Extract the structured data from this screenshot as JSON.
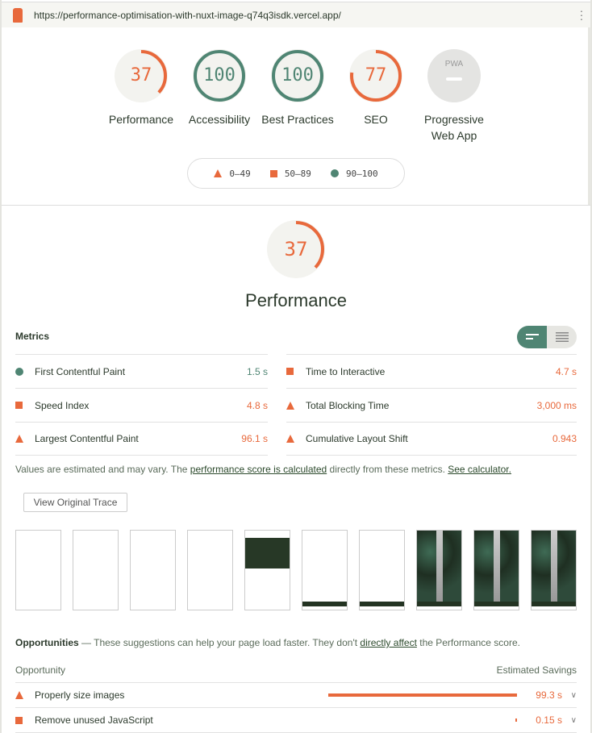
{
  "topbar": {
    "url": "https://performance-optimisation-with-nuxt-image-q74q3isdk.vercel.app/"
  },
  "colors": {
    "fail": "#e8693c",
    "pass": "#4f8573",
    "na": "#e0e0e0"
  },
  "gauges": [
    {
      "score": "37",
      "value": 37,
      "label": "Performance",
      "rating": "fail"
    },
    {
      "score": "100",
      "value": 100,
      "label": "Accessibility",
      "rating": "pass"
    },
    {
      "score": "100",
      "value": 100,
      "label": "Best Practices",
      "rating": "pass"
    },
    {
      "score": "77",
      "value": 77,
      "label": "SEO",
      "rating": "average"
    },
    {
      "score": "PWA",
      "value": null,
      "label": "Progressive Web App",
      "rating": "na"
    }
  ],
  "legend": {
    "fail": "0–49",
    "average": "50–89",
    "pass": "90–100"
  },
  "performance": {
    "score": "37",
    "value": 37,
    "title": "Performance"
  },
  "metrics": {
    "heading": "Metrics",
    "left": [
      {
        "name": "First Contentful Paint",
        "value": "1.5 s",
        "rating": "pass"
      },
      {
        "name": "Speed Index",
        "value": "4.8 s",
        "rating": "average"
      },
      {
        "name": "Largest Contentful Paint",
        "value": "96.1 s",
        "rating": "fail"
      }
    ],
    "right": [
      {
        "name": "Time to Interactive",
        "value": "4.7 s",
        "rating": "average"
      },
      {
        "name": "Total Blocking Time",
        "value": "3,000 ms",
        "rating": "fail"
      },
      {
        "name": "Cumulative Layout Shift",
        "value": "0.943",
        "rating": "fail"
      }
    ],
    "note_pre": "Values are estimated and may vary. The ",
    "note_link1": "performance score is calculated",
    "note_mid": " directly from these metrics. ",
    "note_link2": "See calculator."
  },
  "trace_button": "View Original Trace",
  "opportunities": {
    "heading": "Opportunities",
    "desc_pre": " — These suggestions can help your page load faster. They don't ",
    "desc_link": "directly affect",
    "desc_post": " the Performance score.",
    "col_left": "Opportunity",
    "col_right": "Estimated Savings",
    "items": [
      {
        "name": "Properly size images",
        "savings": "99.3 s",
        "savings_s": 99.3,
        "rating": "fail"
      },
      {
        "name": "Remove unused JavaScript",
        "savings": "0.15 s",
        "savings_s": 0.15,
        "rating": "average"
      }
    ]
  }
}
